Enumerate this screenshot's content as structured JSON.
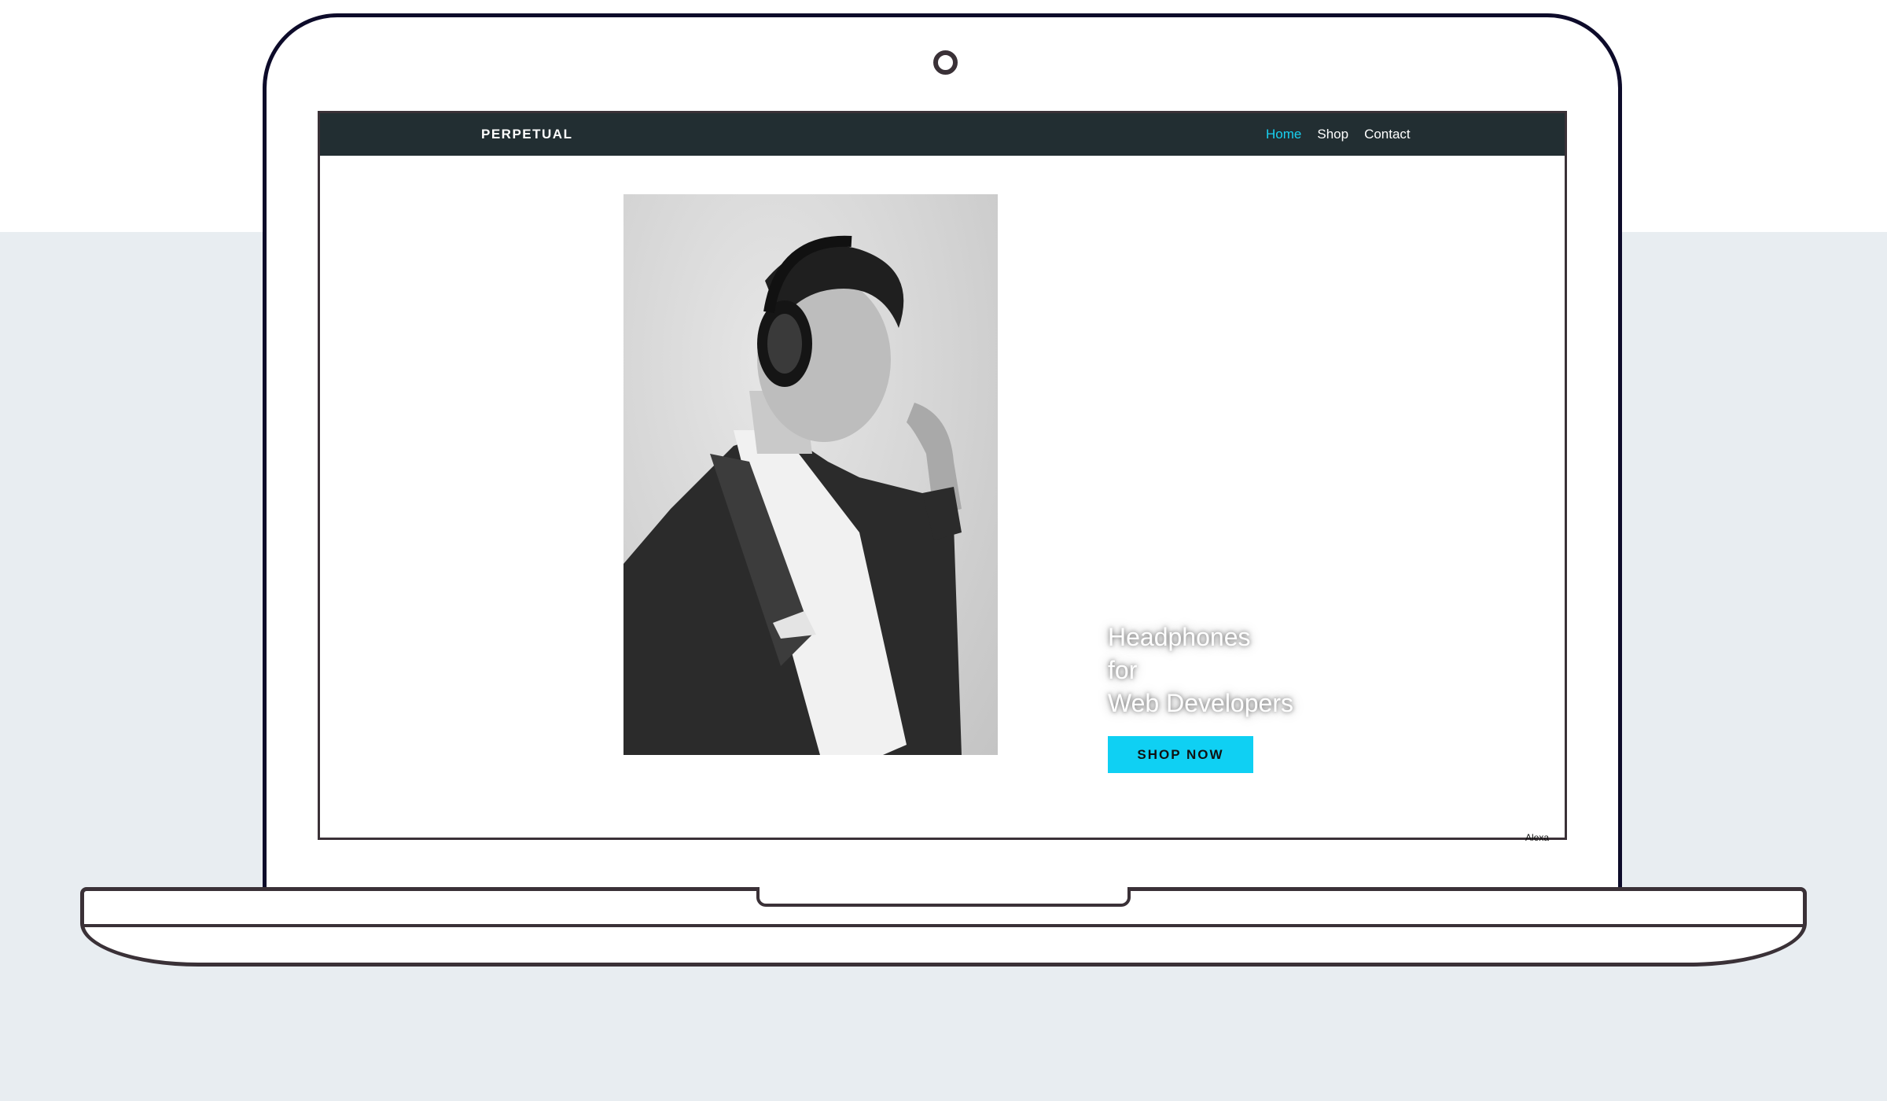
{
  "site": {
    "brand": "PERPETUAL",
    "nav": [
      {
        "label": "Home",
        "active": true
      },
      {
        "label": "Shop",
        "active": false
      },
      {
        "label": "Contact",
        "active": false
      }
    ],
    "hero": {
      "tagline_lines": [
        "Headphones",
        "for",
        "Web Developers"
      ],
      "cta_label": "SHOP NOW",
      "image": "man-wearing-headphones-photo"
    },
    "credit": "Alexa"
  },
  "colors": {
    "navbar_bg": "#222e32",
    "active_link": "#18d0f0",
    "cta_bg": "#0fd0f3",
    "page_band": "#e8edf1",
    "device_outline": "#3a3137"
  }
}
